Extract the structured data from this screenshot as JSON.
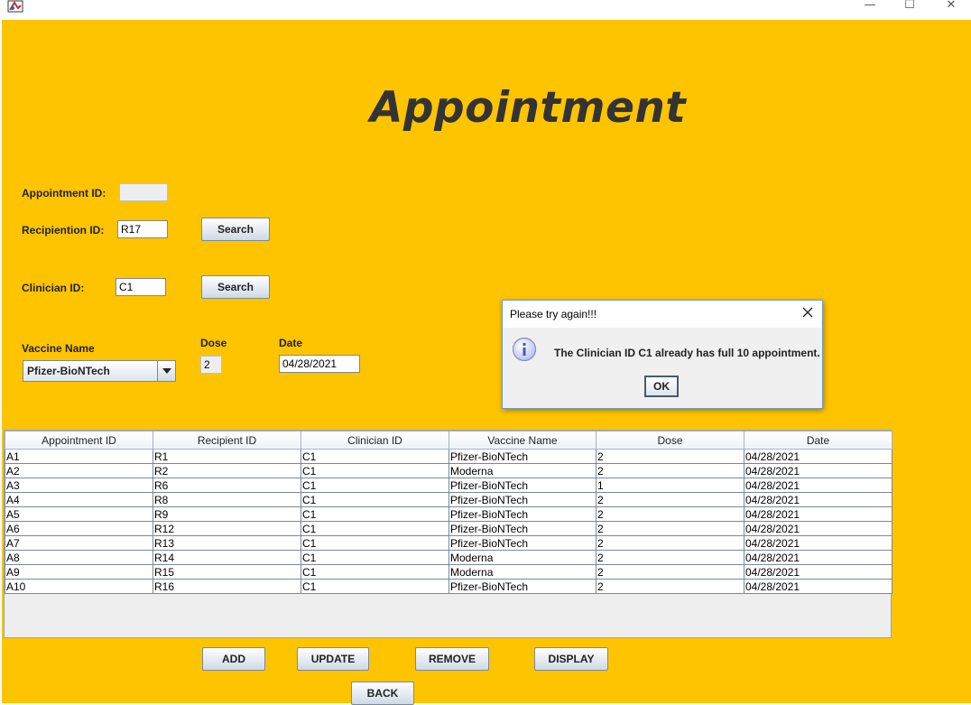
{
  "window": {
    "minimize_glyph": "—",
    "maximize_glyph": "☐",
    "close_glyph": "✕"
  },
  "page_title": "Appointment",
  "form": {
    "appointment_id_label": "Appointment ID:",
    "appointment_id_value": "",
    "recipient_id_label": "Recipiention ID:",
    "recipient_id_value": "R17",
    "recipient_search_label": "Search",
    "clinician_id_label": "Clinician ID:",
    "clinician_id_value": "C1",
    "clinician_search_label": "Search",
    "vaccine_name_label": "Vaccine Name",
    "vaccine_name_value": "Pfizer-BioNTech",
    "dose_label": "Dose",
    "dose_value": "2",
    "date_label": "Date",
    "date_value": "04/28/2021"
  },
  "table": {
    "columns": [
      "Appointment ID",
      "Recipient ID",
      "Clinician ID",
      "Vaccine Name",
      "Dose",
      "Date"
    ],
    "rows": [
      [
        "A1",
        "R1",
        "C1",
        "Pfizer-BioNTech",
        "2",
        "04/28/2021"
      ],
      [
        "A2",
        "R2",
        "C1",
        "Moderna",
        "2",
        "04/28/2021"
      ],
      [
        "A3",
        "R6",
        "C1",
        "Pfizer-BioNTech",
        "1",
        "04/28/2021"
      ],
      [
        "A4",
        "R8",
        "C1",
        "Pfizer-BioNTech",
        "2",
        "04/28/2021"
      ],
      [
        "A5",
        "R9",
        "C1",
        "Pfizer-BioNTech",
        "2",
        "04/28/2021"
      ],
      [
        "A6",
        "R12",
        "C1",
        "Pfizer-BioNTech",
        "2",
        "04/28/2021"
      ],
      [
        "A7",
        "R13",
        "C1",
        "Pfizer-BioNTech",
        "2",
        "04/28/2021"
      ],
      [
        "A8",
        "R14",
        "C1",
        "Moderna",
        "2",
        "04/28/2021"
      ],
      [
        "A9",
        "R15",
        "C1",
        "Moderna",
        "2",
        "04/28/2021"
      ],
      [
        "A10",
        "R16",
        "C1",
        "Pfizer-BioNTech",
        "2",
        "04/28/2021"
      ]
    ]
  },
  "buttons": {
    "add": "ADD",
    "update": "UPDATE",
    "remove": "REMOVE",
    "display": "DISPLAY",
    "back": "BACK"
  },
  "dialog": {
    "title": "Please try again!!!",
    "message": "The Clinician ID C1 already has full 10 appointment.",
    "ok_label": "OK",
    "icon": "info-icon"
  },
  "colors": {
    "background": "#ffc400",
    "title_text": "#333333"
  }
}
